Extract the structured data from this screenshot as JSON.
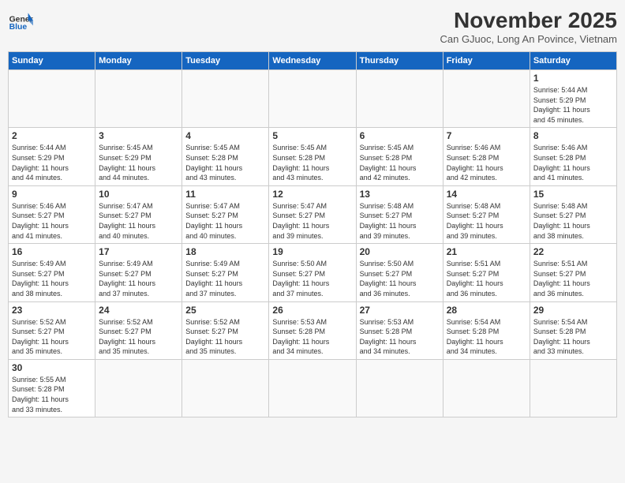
{
  "header": {
    "logo_general": "General",
    "logo_blue": "Blue",
    "month_title": "November 2025",
    "subtitle": "Can GJuoc, Long An Povince, Vietnam"
  },
  "weekdays": [
    "Sunday",
    "Monday",
    "Tuesday",
    "Wednesday",
    "Thursday",
    "Friday",
    "Saturday"
  ],
  "weeks": [
    [
      {
        "day": "",
        "info": ""
      },
      {
        "day": "",
        "info": ""
      },
      {
        "day": "",
        "info": ""
      },
      {
        "day": "",
        "info": ""
      },
      {
        "day": "",
        "info": ""
      },
      {
        "day": "",
        "info": ""
      },
      {
        "day": "1",
        "info": "Sunrise: 5:44 AM\nSunset: 5:29 PM\nDaylight: 11 hours\nand 45 minutes."
      }
    ],
    [
      {
        "day": "2",
        "info": "Sunrise: 5:44 AM\nSunset: 5:29 PM\nDaylight: 11 hours\nand 44 minutes."
      },
      {
        "day": "3",
        "info": "Sunrise: 5:45 AM\nSunset: 5:29 PM\nDaylight: 11 hours\nand 44 minutes."
      },
      {
        "day": "4",
        "info": "Sunrise: 5:45 AM\nSunset: 5:28 PM\nDaylight: 11 hours\nand 43 minutes."
      },
      {
        "day": "5",
        "info": "Sunrise: 5:45 AM\nSunset: 5:28 PM\nDaylight: 11 hours\nand 43 minutes."
      },
      {
        "day": "6",
        "info": "Sunrise: 5:45 AM\nSunset: 5:28 PM\nDaylight: 11 hours\nand 42 minutes."
      },
      {
        "day": "7",
        "info": "Sunrise: 5:46 AM\nSunset: 5:28 PM\nDaylight: 11 hours\nand 42 minutes."
      },
      {
        "day": "8",
        "info": "Sunrise: 5:46 AM\nSunset: 5:28 PM\nDaylight: 11 hours\nand 41 minutes."
      }
    ],
    [
      {
        "day": "9",
        "info": "Sunrise: 5:46 AM\nSunset: 5:27 PM\nDaylight: 11 hours\nand 41 minutes."
      },
      {
        "day": "10",
        "info": "Sunrise: 5:47 AM\nSunset: 5:27 PM\nDaylight: 11 hours\nand 40 minutes."
      },
      {
        "day": "11",
        "info": "Sunrise: 5:47 AM\nSunset: 5:27 PM\nDaylight: 11 hours\nand 40 minutes."
      },
      {
        "day": "12",
        "info": "Sunrise: 5:47 AM\nSunset: 5:27 PM\nDaylight: 11 hours\nand 39 minutes."
      },
      {
        "day": "13",
        "info": "Sunrise: 5:48 AM\nSunset: 5:27 PM\nDaylight: 11 hours\nand 39 minutes."
      },
      {
        "day": "14",
        "info": "Sunrise: 5:48 AM\nSunset: 5:27 PM\nDaylight: 11 hours\nand 39 minutes."
      },
      {
        "day": "15",
        "info": "Sunrise: 5:48 AM\nSunset: 5:27 PM\nDaylight: 11 hours\nand 38 minutes."
      }
    ],
    [
      {
        "day": "16",
        "info": "Sunrise: 5:49 AM\nSunset: 5:27 PM\nDaylight: 11 hours\nand 38 minutes."
      },
      {
        "day": "17",
        "info": "Sunrise: 5:49 AM\nSunset: 5:27 PM\nDaylight: 11 hours\nand 37 minutes."
      },
      {
        "day": "18",
        "info": "Sunrise: 5:49 AM\nSunset: 5:27 PM\nDaylight: 11 hours\nand 37 minutes."
      },
      {
        "day": "19",
        "info": "Sunrise: 5:50 AM\nSunset: 5:27 PM\nDaylight: 11 hours\nand 37 minutes."
      },
      {
        "day": "20",
        "info": "Sunrise: 5:50 AM\nSunset: 5:27 PM\nDaylight: 11 hours\nand 36 minutes."
      },
      {
        "day": "21",
        "info": "Sunrise: 5:51 AM\nSunset: 5:27 PM\nDaylight: 11 hours\nand 36 minutes."
      },
      {
        "day": "22",
        "info": "Sunrise: 5:51 AM\nSunset: 5:27 PM\nDaylight: 11 hours\nand 36 minutes."
      }
    ],
    [
      {
        "day": "23",
        "info": "Sunrise: 5:52 AM\nSunset: 5:27 PM\nDaylight: 11 hours\nand 35 minutes."
      },
      {
        "day": "24",
        "info": "Sunrise: 5:52 AM\nSunset: 5:27 PM\nDaylight: 11 hours\nand 35 minutes."
      },
      {
        "day": "25",
        "info": "Sunrise: 5:52 AM\nSunset: 5:27 PM\nDaylight: 11 hours\nand 35 minutes."
      },
      {
        "day": "26",
        "info": "Sunrise: 5:53 AM\nSunset: 5:28 PM\nDaylight: 11 hours\nand 34 minutes."
      },
      {
        "day": "27",
        "info": "Sunrise: 5:53 AM\nSunset: 5:28 PM\nDaylight: 11 hours\nand 34 minutes."
      },
      {
        "day": "28",
        "info": "Sunrise: 5:54 AM\nSunset: 5:28 PM\nDaylight: 11 hours\nand 34 minutes."
      },
      {
        "day": "29",
        "info": "Sunrise: 5:54 AM\nSunset: 5:28 PM\nDaylight: 11 hours\nand 33 minutes."
      }
    ],
    [
      {
        "day": "30",
        "info": "Sunrise: 5:55 AM\nSunset: 5:28 PM\nDaylight: 11 hours\nand 33 minutes."
      },
      {
        "day": "",
        "info": ""
      },
      {
        "day": "",
        "info": ""
      },
      {
        "day": "",
        "info": ""
      },
      {
        "day": "",
        "info": ""
      },
      {
        "day": "",
        "info": ""
      },
      {
        "day": "",
        "info": ""
      }
    ]
  ]
}
